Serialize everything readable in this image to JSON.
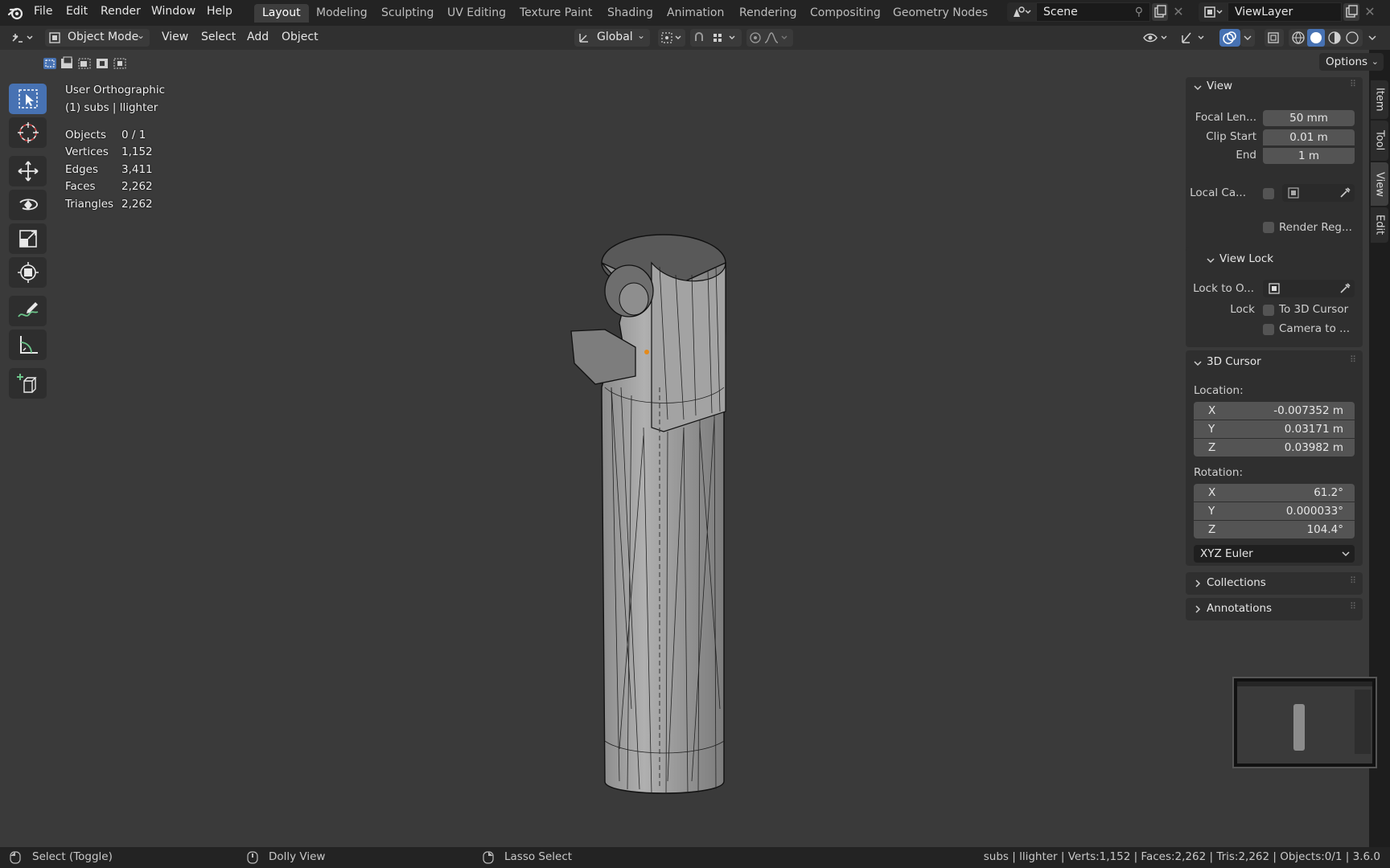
{
  "menu": {
    "file": "File",
    "edit": "Edit",
    "render": "Render",
    "window": "Window",
    "help": "Help"
  },
  "workspaces": [
    "Layout",
    "Modeling",
    "Sculpting",
    "UV Editing",
    "Texture Paint",
    "Shading",
    "Animation",
    "Rendering",
    "Compositing",
    "Geometry Nodes"
  ],
  "scene_name": "Scene",
  "view_layer": "ViewLayer",
  "header": {
    "mode": "Object Mode",
    "view": "View",
    "select": "Select",
    "add": "Add",
    "object": "Object",
    "orientation": "Global",
    "options": "Options"
  },
  "overlay": {
    "view_name": "User Orthographic",
    "object_info": "(1) subs | llighter",
    "stats": [
      {
        "label": "Objects",
        "value": "0 / 1"
      },
      {
        "label": "Vertices",
        "value": "1,152"
      },
      {
        "label": "Edges",
        "value": "3,411"
      },
      {
        "label": "Faces",
        "value": "2,262"
      },
      {
        "label": "Triangles",
        "value": "2,262"
      }
    ]
  },
  "npanel": {
    "view_title": "View",
    "focal_label": "Focal Len...",
    "focal_value": "50 mm",
    "clip_start_label": "Clip Start",
    "clip_start_value": "0.01 m",
    "end_label": "End",
    "end_value": "1 m",
    "local_camera_label": "Local Ca...",
    "render_region_label": "Render Reg...",
    "view_lock_title": "View Lock",
    "lock_to_label": "Lock to O...",
    "lock_label": "Lock",
    "to_cursor_label": "To 3D Cursor",
    "camera_to_label": "Camera to ...",
    "cursor_title": "3D Cursor",
    "location_label": "Location:",
    "location": [
      {
        "axis": "X",
        "value": "-0.007352 m"
      },
      {
        "axis": "Y",
        "value": "0.03171 m"
      },
      {
        "axis": "Z",
        "value": "0.03982 m"
      }
    ],
    "rotation_label": "Rotation:",
    "rotation": [
      {
        "axis": "X",
        "value": "61.2°"
      },
      {
        "axis": "Y",
        "value": "0.000033°"
      },
      {
        "axis": "Z",
        "value": "104.4°"
      }
    ],
    "rotation_mode": "XYZ Euler",
    "collections_title": "Collections",
    "annotations_title": "Annotations"
  },
  "side_tabs": [
    "Item",
    "Tool",
    "View",
    "Edit"
  ],
  "status": {
    "left1": "Select (Toggle)",
    "left2": "Dolly View",
    "left3": "Lasso Select",
    "right": "subs | llighter | Verts:1,152 | Faces:2,262 | Tris:2,262 | Objects:0/1 | 3.6.0"
  },
  "colors": {
    "active": "#4772b3",
    "viewport_bg": "#3a3a3a",
    "panel_bg": "#2f2f2f"
  }
}
